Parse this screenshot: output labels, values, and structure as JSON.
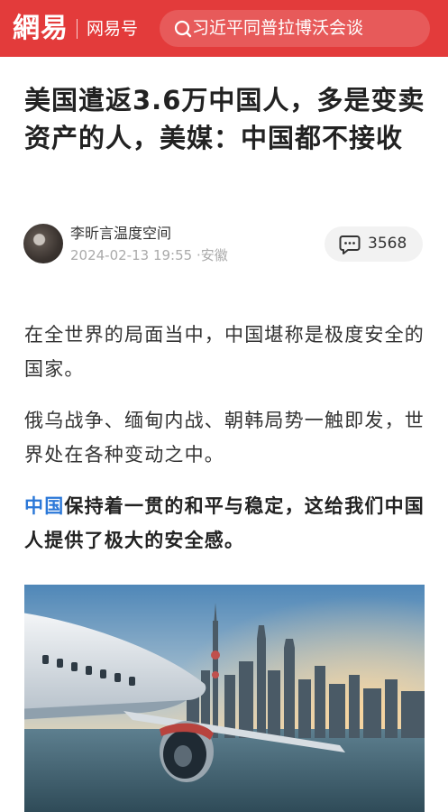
{
  "header": {
    "logo_text": "網易",
    "channel_label": "网易号",
    "search_text": "习近平同普拉博沃会谈",
    "bg_color": "#e33b3b"
  },
  "article": {
    "title": "美国遣返3.6万中国人，多是变卖资产的人，美媒：中国都不接收",
    "author": "李昕言温度空间",
    "date": "2024-02-13 19:55",
    "location": "安徽",
    "comment_count": "3568",
    "paragraphs": {
      "p1": "在全世界的局面当中，中国堪称是极度安全的国家。",
      "p2": "俄乌战争、缅甸内战、朝韩局势一触即发，世界处在各种变动之中。",
      "p3_link": "中国",
      "p3_rest": "保持着一贯的和平与稳定，这给我们中国人提供了极大的安全感。"
    },
    "link_color": "#2b78d8"
  }
}
